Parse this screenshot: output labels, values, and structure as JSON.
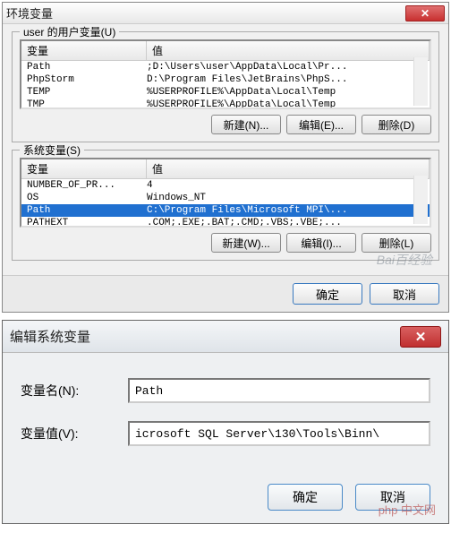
{
  "dialog1": {
    "title": "环境变量",
    "close_glyph": "✕",
    "user_group_label": "user 的用户变量(U)",
    "col_var": "变量",
    "col_val": "值",
    "user_rows": [
      {
        "name": "Path",
        "value": ";D:\\Users\\user\\AppData\\Local\\Pr..."
      },
      {
        "name": "PhpStorm",
        "value": "D:\\Program Files\\JetBrains\\PhpS..."
      },
      {
        "name": "TEMP",
        "value": "%USERPROFILE%\\AppData\\Local\\Temp"
      },
      {
        "name": "TMP",
        "value": "%USERPROFILE%\\AppData\\Local\\Temp"
      }
    ],
    "sys_group_label": "系统变量(S)",
    "sys_rows": [
      {
        "name": "NUMBER_OF_PR...",
        "value": "4"
      },
      {
        "name": "OS",
        "value": "Windows_NT"
      },
      {
        "name": "Path",
        "value": "C:\\Program Files\\Microsoft MPI\\..."
      },
      {
        "name": "PATHEXT",
        "value": ".COM;.EXE;.BAT;.CMD;.VBS;.VBE;..."
      }
    ],
    "btn_new": "新建(N)...",
    "btn_edit": "编辑(E)...",
    "btn_delete": "删除(D)",
    "btn_new2": "新建(W)...",
    "btn_edit2": "编辑(I)...",
    "btn_delete2": "删除(L)",
    "btn_ok": "确定",
    "btn_cancel": "取消",
    "watermark": "Bai百经验"
  },
  "dialog2": {
    "title": "编辑系统变量",
    "close_glyph": "✕",
    "label_name": "变量名(N):",
    "label_value": "变量值(V):",
    "value_name": "Path",
    "value_value": "icrosoft SQL Server\\130\\Tools\\Binn\\",
    "btn_ok": "确定",
    "btn_cancel": "取消",
    "watermark": "php 中文网"
  }
}
